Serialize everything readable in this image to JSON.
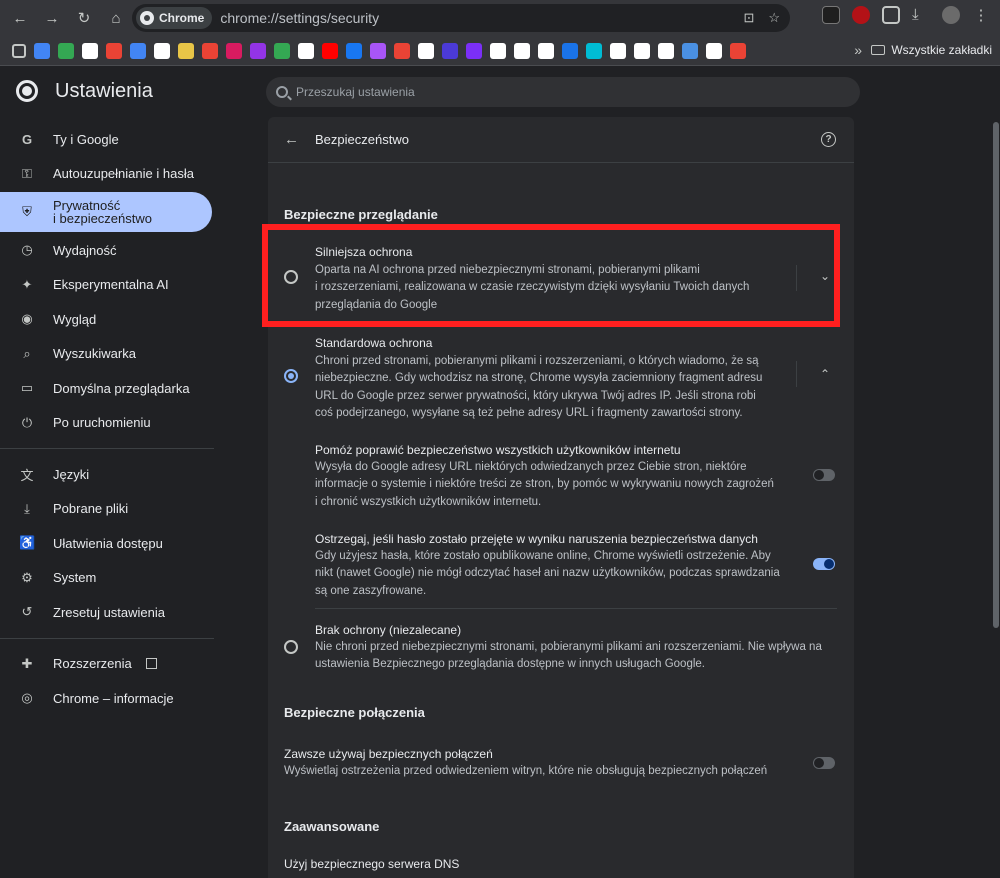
{
  "browser": {
    "chip_label": "Chrome",
    "url": "chrome://settings/security",
    "bookmarks_all": "Wszystkie zakładki",
    "bookmark_colors": [
      "#4285f4",
      "#34a853",
      "#ffffff",
      "#ea4335",
      "#4285f4",
      "#ffffff",
      "#e8c547",
      "#ea4335",
      "#d81b60",
      "#9334e6",
      "#34a853",
      "#ffffff",
      "#ff0000",
      "#1877f2",
      "#a855f7",
      "#ea4335",
      "#ffffff",
      "#4b3ad6",
      "#7b2ff7",
      "#ffffff",
      "#ffffff",
      "#ffffff",
      "#1a73e8",
      "#00bcd4",
      "#ffffff",
      "#ffffff",
      "#ffffff",
      "#4a90e2",
      "#ffffff",
      "#ea4335"
    ]
  },
  "header": {
    "title": "Ustawienia",
    "search_placeholder": "Przeszukaj ustawienia"
  },
  "sidebar": {
    "items": [
      {
        "label": "Ty i Google",
        "icon": "G"
      },
      {
        "label": "Autouzupełnianie i hasła",
        "icon": "⚿"
      },
      {
        "label_1": "Prywatność",
        "label_2": "i bezpieczeństwo",
        "icon": "⛨"
      },
      {
        "label": "Wydajność",
        "icon": "◷"
      },
      {
        "label": "Eksperymentalna AI",
        "icon": "✦"
      },
      {
        "label": "Wygląd",
        "icon": "◉"
      },
      {
        "label": "Wyszukiwarka",
        "icon": "⌕"
      },
      {
        "label": "Domyślna przeglądarka",
        "icon": "▭"
      },
      {
        "label": "Po uruchomieniu",
        "icon": "⏻"
      },
      {
        "label": "Języki",
        "icon": "文"
      },
      {
        "label": "Pobrane pliki",
        "icon": "⤓"
      },
      {
        "label": "Ułatwienia dostępu",
        "icon": "♿"
      },
      {
        "label": "System",
        "icon": "⚙"
      },
      {
        "label": "Zresetuj ustawienia",
        "icon": "↺"
      },
      {
        "label": "Rozszerzenia",
        "icon": "✚"
      },
      {
        "label": "Chrome – informacje",
        "icon": "◎"
      }
    ]
  },
  "panel": {
    "title": "Bezpieczeństwo",
    "section_safe_browsing": "Bezpieczne przeglądanie",
    "enhanced": {
      "title": "Silniejsza ochrona",
      "desc": [
        "Oparta na AI ochrona przed niebezpiecznymi stronami, pobieranymi plikami",
        "i rozszerzeniami, realizowana w czasie rzeczywistym dzięki wysyłaniu Twoich danych",
        "przeglądania do Google"
      ]
    },
    "standard": {
      "title": "Standardowa ochrona",
      "desc": [
        "Chroni przed stronami, pobieranymi plikami i rozszerzeniami, o których wiadomo, że są",
        "niebezpieczne. Gdy wchodzisz na stronę, Chrome wysyła zaciemniony fragment adresu",
        "URL do Google przez serwer prywatności, który ukrywa Twój adres IP. Jeśli strona robi",
        "coś podejrzanego, wysyłane są też pełne adresy URL i fragmenty zawartości strony."
      ]
    },
    "help_improve": {
      "title": "Pomóż poprawić bezpieczeństwo wszystkich użytkowników internetu",
      "desc": [
        "Wysyła do Google adresy URL niektórych odwiedzanych przez Ciebie stron, niektóre",
        "informacje o systemie i niektóre treści ze stron, by pomóc w wykrywaniu nowych zagrożeń",
        "i chronić wszystkich użytkowników internetu."
      ],
      "enabled": false
    },
    "password_warn": {
      "title": "Ostrzegaj, jeśli hasło zostało przejęte w wyniku naruszenia bezpieczeństwa danych",
      "desc": [
        "Gdy użyjesz hasła, które zostało opublikowane online, Chrome wyświetli ostrzeżenie. Aby",
        "nikt (nawet Google) nie mógł odczytać haseł ani nazw użytkowników, podczas sprawdzania",
        "są one zaszyfrowane."
      ],
      "enabled": true
    },
    "no_protection": {
      "title": "Brak ochrony (niezalecane)",
      "desc": [
        "Nie chroni przed niebezpiecznymi stronami, pobieranymi plikami ani rozszerzeniami. Nie wpływa na",
        "ustawienia Bezpiecznego przeglądania dostępne w innych usługach Google."
      ]
    },
    "section_secure_connections": "Bezpieczne połączenia",
    "https_always": {
      "title": "Zawsze używaj bezpiecznych połączeń",
      "desc": "Wyświetlaj ostrzeżenia przed odwiedzeniem witryn, które nie obsługują bezpiecznych połączeń",
      "enabled": false
    },
    "section_advanced": "Zaawansowane",
    "dns": {
      "title": "Użyj bezpiecznego serwera DNS"
    },
    "selected_option": "standard"
  },
  "colors": {
    "highlight_box": "#ff1f1f",
    "active_nav": "#adc6ff",
    "toggle_on": "#8ab4f8"
  }
}
